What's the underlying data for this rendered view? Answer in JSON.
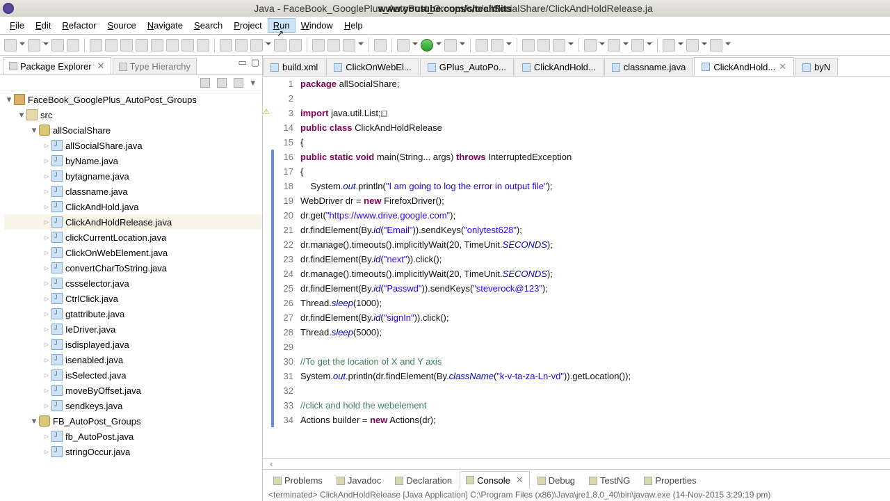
{
  "titlebar": {
    "text": "Java - FaceBook_GooglePlus_AutoPost_Groups/src/allSocialShare/ClickAndHoldRelease.ja",
    "overlay": "www.youtube.com/c/techflits"
  },
  "menus": [
    "File",
    "Edit",
    "Refactor",
    "Source",
    "Navigate",
    "Search",
    "Project",
    "Run",
    "Window",
    "Help"
  ],
  "menu_hot_index": 7,
  "sidebar": {
    "tabs": [
      {
        "label": "Package Explorer",
        "active": true,
        "closable": true
      },
      {
        "label": "Type Hierarchy",
        "active": false,
        "closable": false
      }
    ],
    "tree": [
      {
        "d": 0,
        "kind": "proj",
        "open": true,
        "label": "FaceBook_GooglePlus_AutoPost_Groups"
      },
      {
        "d": 1,
        "kind": "fold",
        "open": true,
        "label": "src"
      },
      {
        "d": 2,
        "kind": "pkg",
        "open": true,
        "label": "allSocialShare"
      },
      {
        "d": 3,
        "kind": "java",
        "label": "allSocialShare.java"
      },
      {
        "d": 3,
        "kind": "java",
        "label": "byName.java"
      },
      {
        "d": 3,
        "kind": "java",
        "label": "bytagname.java"
      },
      {
        "d": 3,
        "kind": "java",
        "label": "classname.java"
      },
      {
        "d": 3,
        "kind": "java",
        "label": "ClickAndHold.java"
      },
      {
        "d": 3,
        "kind": "java",
        "label": "ClickAndHoldRelease.java",
        "selected": true
      },
      {
        "d": 3,
        "kind": "java",
        "label": "clickCurrentLocation.java"
      },
      {
        "d": 3,
        "kind": "java",
        "label": "ClickOnWebElement.java"
      },
      {
        "d": 3,
        "kind": "java",
        "label": "convertCharToString.java"
      },
      {
        "d": 3,
        "kind": "java",
        "label": "cssselector.java"
      },
      {
        "d": 3,
        "kind": "java",
        "label": "CtrlClick.java"
      },
      {
        "d": 3,
        "kind": "java",
        "label": "gtattribute.java"
      },
      {
        "d": 3,
        "kind": "java",
        "label": "IeDriver.java"
      },
      {
        "d": 3,
        "kind": "java",
        "label": "isdisplayed.java"
      },
      {
        "d": 3,
        "kind": "java",
        "label": "isenabled.java"
      },
      {
        "d": 3,
        "kind": "java",
        "label": "isSelected.java"
      },
      {
        "d": 3,
        "kind": "java",
        "label": "moveByOffset.java"
      },
      {
        "d": 3,
        "kind": "java",
        "label": "sendkeys.java"
      },
      {
        "d": 2,
        "kind": "pkg",
        "open": true,
        "label": "FB_AutoPost_Groups"
      },
      {
        "d": 3,
        "kind": "java",
        "label": "fb_AutoPost.java"
      },
      {
        "d": 3,
        "kind": "java",
        "label": "stringOccur.java"
      }
    ]
  },
  "editor_tabs": [
    {
      "label": "build.xml"
    },
    {
      "label": "ClickOnWebEl..."
    },
    {
      "label": "GPlus_AutoPo..."
    },
    {
      "label": "ClickAndHold..."
    },
    {
      "label": "classname.java"
    },
    {
      "label": "ClickAndHold...",
      "active": true,
      "closable": true
    },
    {
      "label": "byN"
    }
  ],
  "code": {
    "lines": [
      {
        "n": 1,
        "blue": false,
        "html": "<span class='kw'>package</span> allSocialShare;"
      },
      {
        "n": 2,
        "blue": false,
        "html": ""
      },
      {
        "n": 3,
        "blue": false,
        "marker": "warn",
        "fold": true,
        "html": "<span class='kw'>import</span> java.util.List;<span class='collapse'>☐</span>"
      },
      {
        "n": 14,
        "blue": false,
        "html": "<span class='kw'>public</span> <span class='kw'>class</span> ClickAndHoldRelease"
      },
      {
        "n": 15,
        "blue": false,
        "html": "{"
      },
      {
        "n": 16,
        "blue": true,
        "fold": true,
        "html": "<span class='kw'>public</span> <span class='kw'>static</span> <span class='kw'>void</span> main(String... args) <span class='kw'>throws</span> InterruptedException"
      },
      {
        "n": 17,
        "blue": true,
        "html": "{"
      },
      {
        "n": 18,
        "blue": true,
        "html": "    System.<span class='fld'>out</span>.println(<span class='str'>\"I am going to log the error in output file\"</span>);"
      },
      {
        "n": 19,
        "blue": true,
        "html": "WebDriver dr = <span class='kw'>new</span> FirefoxDriver();"
      },
      {
        "n": 20,
        "blue": true,
        "html": "dr.get(<span class='str'>\"https://www.drive.google.com\"</span>);"
      },
      {
        "n": 21,
        "blue": true,
        "html": "dr.findElement(By.<span class='fld'>id</span>(<span class='str'>\"Email\"</span>)).sendKeys(<span class='str'>\"onlytest628\"</span>);"
      },
      {
        "n": 22,
        "blue": true,
        "html": "dr.manage().timeouts().implicitlyWait(20, TimeUnit.<span class='fld'>SECONDS</span>);"
      },
      {
        "n": 23,
        "blue": true,
        "html": "dr.findElement(By.<span class='fld'>id</span>(<span class='str'>\"next\"</span>)).click();"
      },
      {
        "n": 24,
        "blue": true,
        "html": "dr.manage().timeouts().implicitlyWait(20, TimeUnit.<span class='fld'>SECONDS</span>);"
      },
      {
        "n": 25,
        "blue": true,
        "html": "dr.findElement(By.<span class='fld'>id</span>(<span class='str'>\"Passwd\"</span>)).sendKeys(<span class='str'>\"steverock@123\"</span>);"
      },
      {
        "n": 26,
        "blue": true,
        "html": "Thread.<span class='fld'>sleep</span>(1000);"
      },
      {
        "n": 27,
        "blue": true,
        "html": "dr.findElement(By.<span class='fld'>id</span>(<span class='str'>\"signIn\"</span>)).click();"
      },
      {
        "n": 28,
        "blue": true,
        "html": "Thread.<span class='fld'>sleep</span>(5000);"
      },
      {
        "n": 29,
        "blue": true,
        "html": ""
      },
      {
        "n": 30,
        "blue": true,
        "html": "<span class='cmt'>//To get the location of X and Y axis</span>"
      },
      {
        "n": 31,
        "blue": true,
        "html": "System.<span class='fld'>out</span>.println(dr.findElement(By.<span class='fld'>className</span>(<span class='str'>\"k-v-ta-za-Ln-vd\"</span>)).getLocation());"
      },
      {
        "n": 32,
        "blue": true,
        "html": ""
      },
      {
        "n": 33,
        "blue": true,
        "html": "<span class='cmt'>//click and hold the webelement</span>"
      },
      {
        "n": 34,
        "blue": true,
        "html": "Actions builder = <span class='kw'>new</span> Actions(dr);"
      }
    ]
  },
  "bottom_tabs": [
    {
      "label": "Problems"
    },
    {
      "label": "Javadoc"
    },
    {
      "label": "Declaration"
    },
    {
      "label": "Console",
      "active": true,
      "closable": true
    },
    {
      "label": "Debug"
    },
    {
      "label": "TestNG"
    },
    {
      "label": "Properties"
    }
  ],
  "console_status": "<terminated> ClickAndHoldRelease [Java Application] C:\\Program Files (x86)\\Java\\jre1.8.0_40\\bin\\javaw.exe (14-Nov-2015 3:29:19 pm)"
}
